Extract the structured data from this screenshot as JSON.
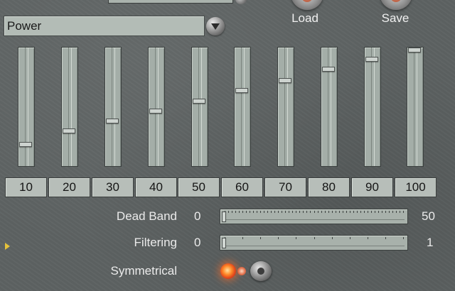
{
  "header": {
    "load_label": "Load",
    "save_label": "Save"
  },
  "preset": {
    "selected": "Power"
  },
  "eq": {
    "bands": [
      {
        "label": "10",
        "level": 0.07
      },
      {
        "label": "20",
        "level": 0.2
      },
      {
        "label": "30",
        "level": 0.3
      },
      {
        "label": "40",
        "level": 0.4
      },
      {
        "label": "50",
        "level": 0.5
      },
      {
        "label": "60",
        "level": 0.6
      },
      {
        "label": "70",
        "level": 0.7
      },
      {
        "label": "80",
        "level": 0.81
      },
      {
        "label": "90",
        "level": 0.91
      },
      {
        "label": "100",
        "level": 1.0
      }
    ]
  },
  "dead_band": {
    "label": "Dead Band",
    "min": "0",
    "max": "50",
    "value": 0
  },
  "filtering": {
    "label": "Filtering",
    "min": "0",
    "max": "1",
    "value": 0
  },
  "symmetrical": {
    "label": "Symmetrical",
    "state": "on"
  },
  "colors": {
    "led_on": "#ff8c2a",
    "panel": "#5d6262",
    "control_face": "#aab3ad",
    "marker": "#e5c23b"
  }
}
